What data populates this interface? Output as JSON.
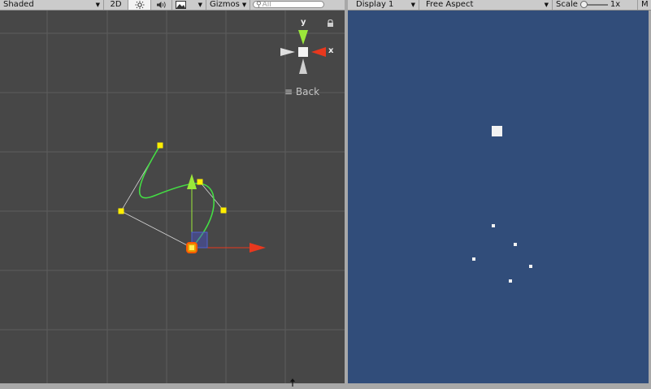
{
  "scene_toolbar": {
    "shading_mode": "Shaded",
    "mode_2d": "2D",
    "gizmos_label": "Gizmos",
    "search_placeholder": "All"
  },
  "scene_view": {
    "back_label": "Back",
    "gizmo_axis_y": "y",
    "gizmo_axis_x": "x"
  },
  "game_toolbar": {
    "display": "Display 1",
    "aspect": "Free Aspect",
    "scale_label": "Scale",
    "scale_value": "1x",
    "overflow_label": "M"
  },
  "colors": {
    "scene_background": "#474747",
    "game_background": "#314d7a",
    "curve_green": "#44dd44",
    "control_point_yellow": "#ffee00",
    "x_axis_red": "#e8381e",
    "y_axis_green": "#9be83a"
  }
}
